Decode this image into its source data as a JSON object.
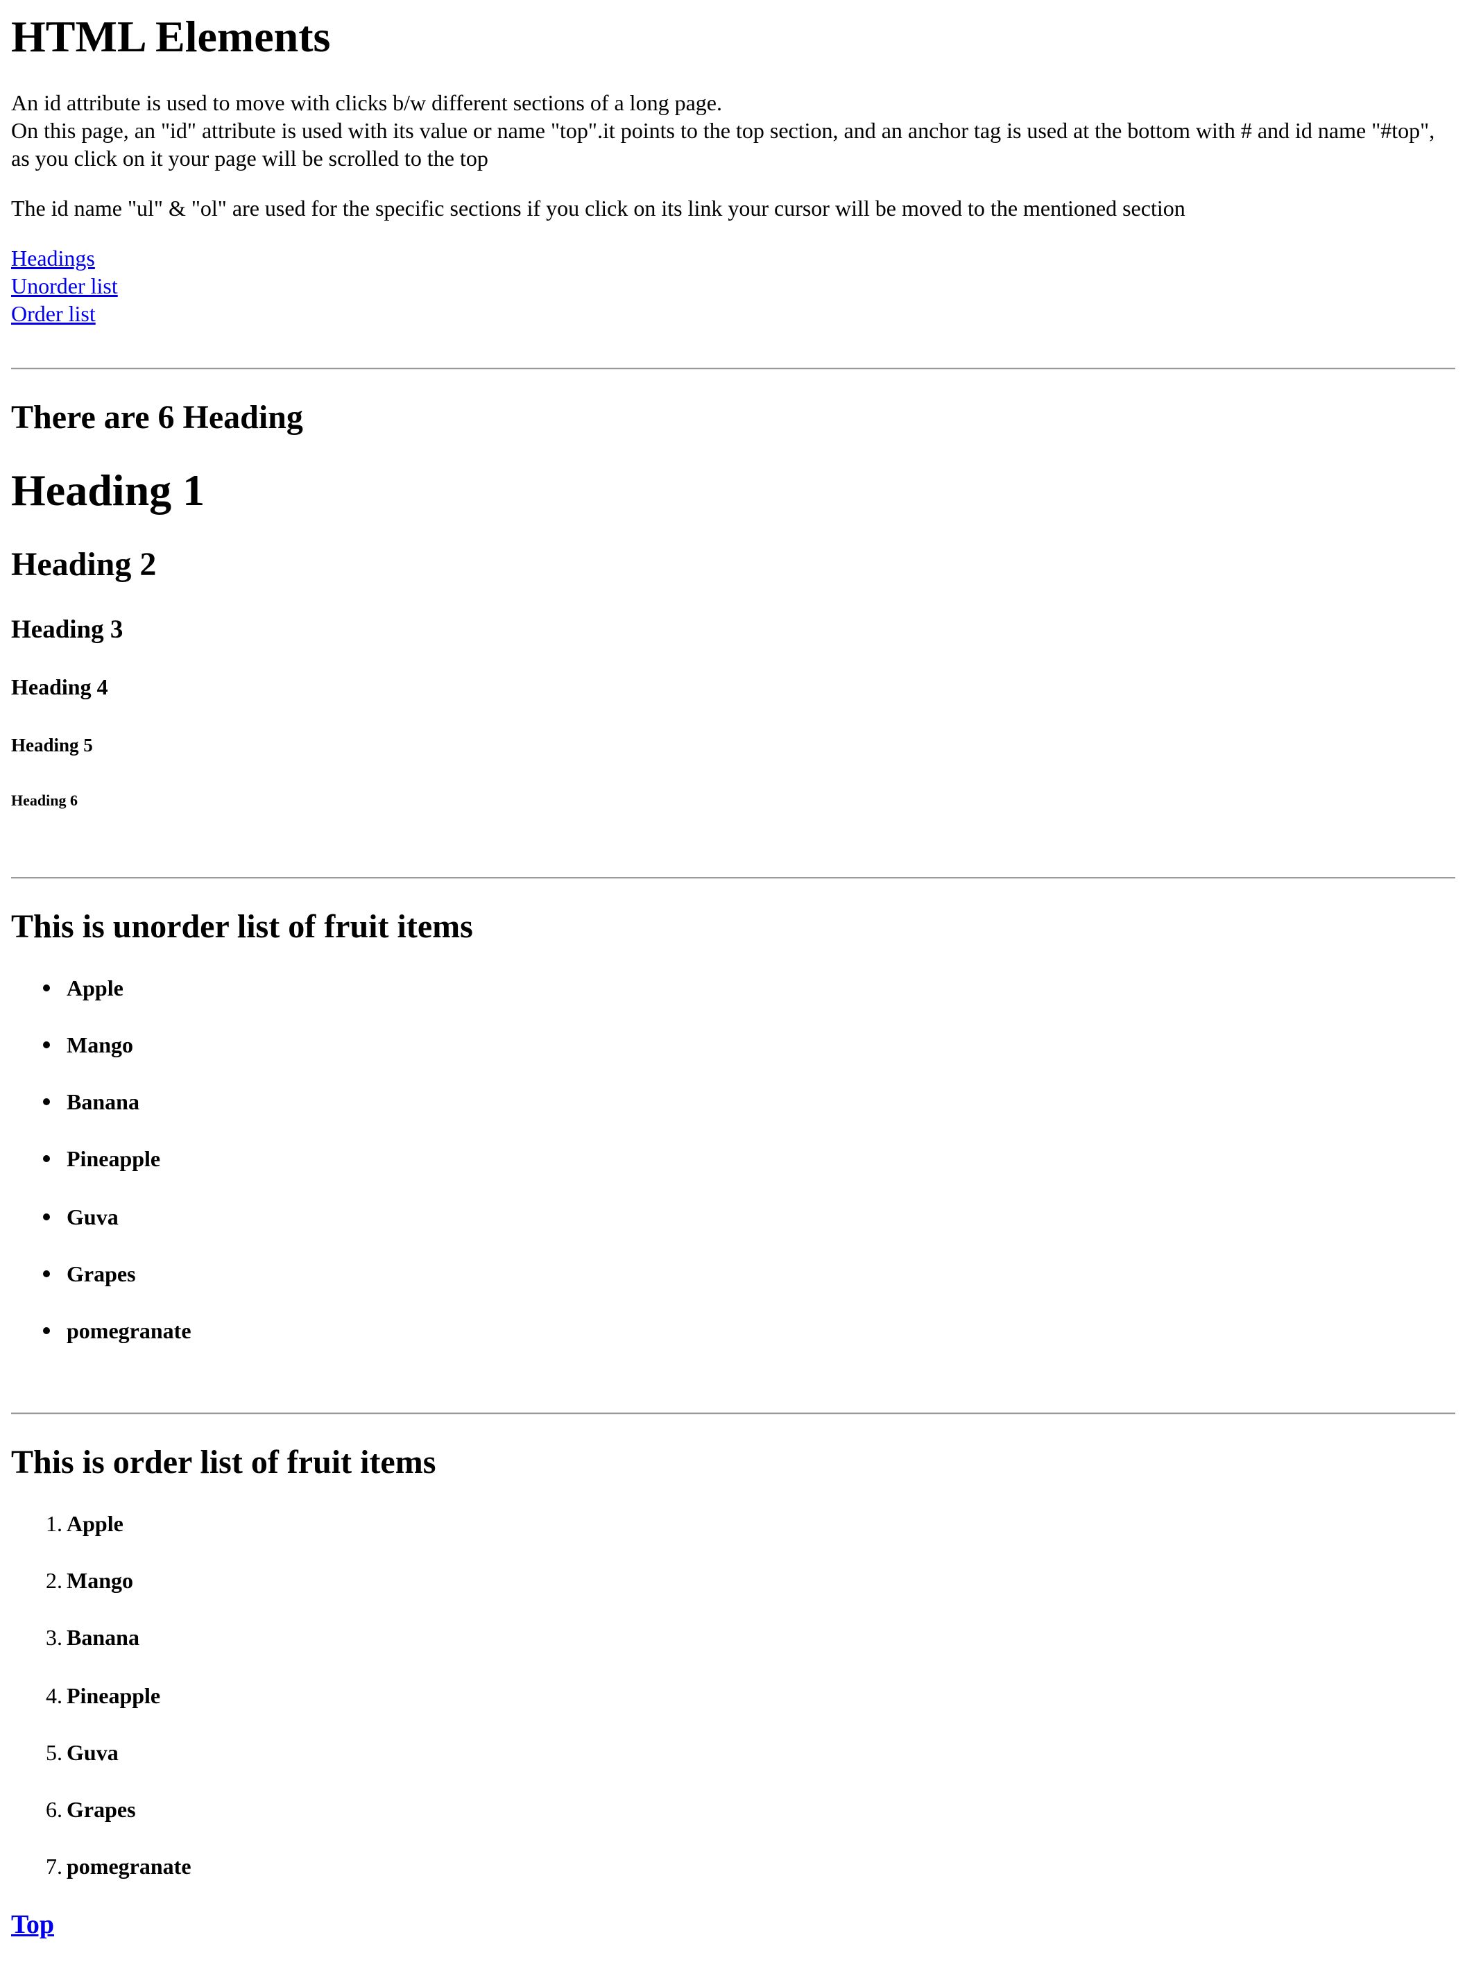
{
  "page": {
    "title": "HTML Elements",
    "intro_line_1": "An id attribute is used to move with clicks b/w different sections of a long page.",
    "intro_line_2": "On this page, an \"id\" attribute is used with its value or name \"top\".it points to the top section, and an anchor tag is used at the bottom with # and id name \"#top\", as you click on it your page will be scrolled to the top",
    "intro_paragraph_2": "The id name \"ul\" & \"ol\" are used for the specific sections if you click on its link your cursor will be moved to the mentioned section"
  },
  "nav_links": {
    "headings": "Headings",
    "unorder_list": "Unorder list",
    "order_list": "Order list"
  },
  "headings_section": {
    "title": "There are 6 Heading",
    "h1": "Heading 1",
    "h2": "Heading 2",
    "h3": "Heading 3",
    "h4": "Heading 4",
    "h5": "Heading 5",
    "h6": "Heading 6"
  },
  "unordered_section": {
    "title": "This is unorder list of fruit items",
    "items": [
      "Apple",
      "Mango",
      "Banana",
      "Pineapple",
      "Guva",
      "Grapes",
      "pomegranate"
    ]
  },
  "ordered_section": {
    "title": "This is order list of fruit items",
    "items": [
      "Apple",
      "Mango",
      "Banana",
      "Pineapple",
      "Guva",
      "Grapes",
      "pomegranate"
    ],
    "markers": [
      "1.",
      "2.",
      "3.",
      "4.",
      "5.",
      "6.",
      "7."
    ]
  },
  "footer": {
    "top_link": "Top"
  }
}
